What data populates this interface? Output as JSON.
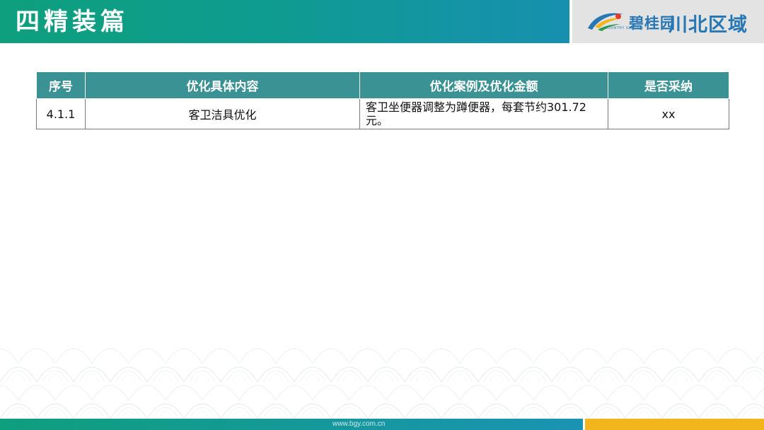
{
  "header": {
    "title": "四精装篇",
    "colors": {
      "bar_start": "#0e9f7d",
      "bar_end": "#1790b0"
    }
  },
  "brand": {
    "name": "碧桂园",
    "region": "川北区域",
    "english": "COUNTRY GARDEN",
    "logo_icon": "country-garden-logo",
    "color": "#2877b5"
  },
  "table": {
    "headers": [
      "序号",
      "优化具体内容",
      "优化案例及优化金额",
      "是否采纳"
    ],
    "header_color": "#3a9294",
    "rows": [
      {
        "id": "4.1.1",
        "content": "客卫洁具优化",
        "case": "客卫坐便器调整为蹲便器，每套节约301.72元。",
        "adopted": "xx"
      }
    ]
  },
  "footer": {
    "url": "www.bgy.com.cn",
    "accent_color": "#f2b51c"
  }
}
